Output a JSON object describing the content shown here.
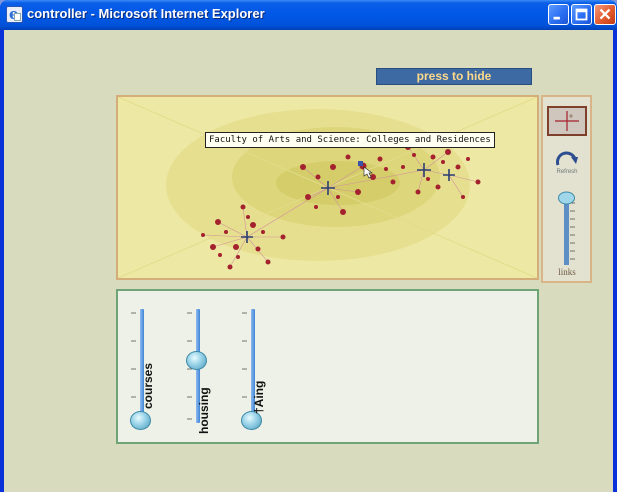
{
  "window": {
    "title": "controller - Microsoft Internet Explorer",
    "icon": "ie-icon",
    "controls": [
      "minimize-icon",
      "maximize-icon",
      "close-icon"
    ]
  },
  "header": {
    "hide_label": "press to hide"
  },
  "map": {
    "tooltip": "Faculty of Arts and Science: Colleges and Residences",
    "colors": {
      "background": "#ede9a5",
      "node": "#a4212e",
      "hub": "#2c3f73",
      "ring": "#d5d06e"
    }
  },
  "tools": {
    "pan_icon": "crosshair-icon",
    "refresh_icon": "refresh-icon",
    "refresh_label": "Refresh",
    "links_label": "links"
  },
  "filters": {
    "sliders": [
      {
        "label": "courses",
        "level": 0.0
      },
      {
        "label": "housing",
        "level": 0.5
      },
      {
        "label": "†Aing",
        "level": 0.0
      }
    ]
  }
}
